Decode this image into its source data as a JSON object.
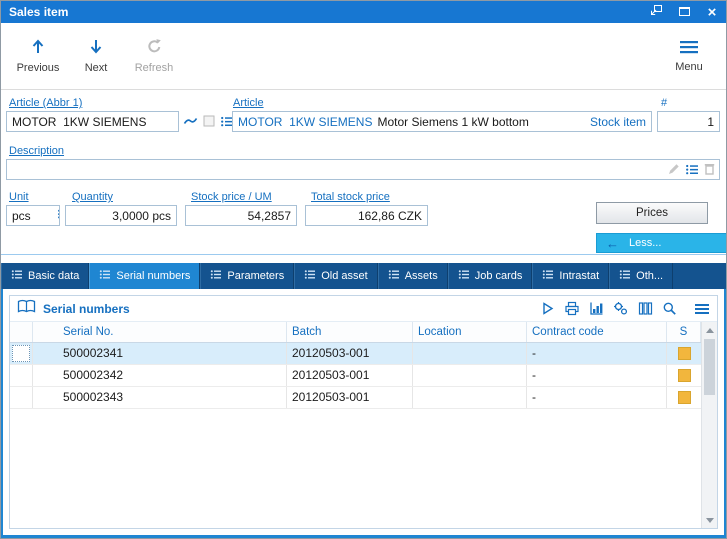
{
  "window": {
    "title": "Sales item",
    "controls": [
      "dock",
      "maximize",
      "close"
    ]
  },
  "toolbar": {
    "previous_label": "Previous",
    "next_label": "Next",
    "refresh_label": "Refresh",
    "menu_label": "Menu"
  },
  "form": {
    "article_abbr_label": "Article (Abbr 1)",
    "article_abbr_value": "MOTOR  1KW SIEMENS",
    "article_label": "Article",
    "article_link": "MOTOR  1KW SIEMENS",
    "article_name": "Motor Siemens 1 kW bottom",
    "stock_item_link": "Stock item",
    "number_label": "#",
    "number_value": "1",
    "description_label": "Description",
    "description_value": "",
    "unit_label": "Unit",
    "unit_value": "pcs",
    "quantity_label": "Quantity",
    "quantity_value": "3,0000 pcs",
    "stock_price_label": "Stock price / UM",
    "stock_price_value": "54,2857",
    "total_label": "Total stock price",
    "total_value": "162,86 CZK",
    "prices_button": "Prices",
    "less_button": "Less...",
    "less_arrow": "←"
  },
  "tabs": [
    {
      "label": "Basic data",
      "active": false
    },
    {
      "label": "Serial numbers",
      "active": true
    },
    {
      "label": "Parameters",
      "active": false
    },
    {
      "label": "Old asset",
      "active": false
    },
    {
      "label": "Assets",
      "active": false
    },
    {
      "label": "Job cards",
      "active": false
    },
    {
      "label": "Intrastat",
      "active": false
    },
    {
      "label": "Oth...",
      "active": false
    }
  ],
  "grid": {
    "title": "Serial numbers",
    "toolbar_icons": [
      "run",
      "print",
      "chart",
      "gears",
      "columns",
      "search",
      "menu"
    ],
    "columns": [
      "Serial No.",
      "Batch",
      "Location",
      "Contract code",
      "S"
    ],
    "selected_row": 0,
    "rows": [
      {
        "serial_no": "500002341",
        "batch": "20120503-001",
        "location": "",
        "contract_code": "-",
        "status_color": "#F2B63D"
      },
      {
        "serial_no": "500002342",
        "batch": "20120503-001",
        "location": "",
        "contract_code": "-",
        "status_color": "#F2B63D"
      },
      {
        "serial_no": "500002343",
        "batch": "20120503-001",
        "location": "",
        "contract_code": "-",
        "status_color": "#F2B63D"
      }
    ]
  },
  "colors": {
    "titlebar": "#1777D2",
    "accent": "#1670C0",
    "tabbar": "#14538F",
    "tab_active": "#1F86D2",
    "less_button": "#2AB4E8",
    "status_yellow": "#F2B63D",
    "selected_row": "#D8EDFB"
  }
}
